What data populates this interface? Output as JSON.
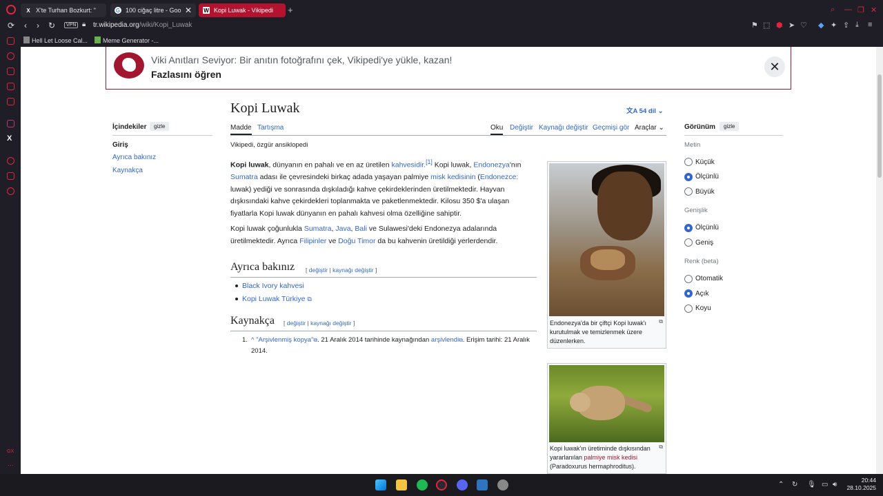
{
  "browser": {
    "tabs": [
      {
        "label": "X'te Turhan Bozkurt: \"",
        "favicon": "x-icon"
      },
      {
        "label": "100 ciğaç litre - Goo",
        "favicon": "google-icon"
      },
      {
        "label": "Kopi Luwak - Vikipedi",
        "favicon": "wikipedia-icon",
        "active": true
      }
    ],
    "vpn_label": "VPN",
    "url_domain": "tr.wikipedia.org",
    "url_path": "/wiki/Kopi_Luwak",
    "bookmarks": [
      "Hell Let Loose Cal...",
      "Meme Generator -..."
    ],
    "accent_color": "#e0263d",
    "active_tab_color": "#b3132e"
  },
  "banner": {
    "text": "Viki Anıtları Seviyor: Bir anıtın fotoğrafını çek, Vikipedi'ye yükle, kazan!",
    "link": "Fazlasını öğren",
    "close": "✕"
  },
  "toc": {
    "title": "İçindekiler",
    "hide": "gizle",
    "items": [
      "Giriş",
      "Ayrıca bakınız",
      "Kaynakça"
    ]
  },
  "article": {
    "title": "Kopi Luwak",
    "languages": "54 dil",
    "tabs_left": [
      "Madde",
      "Tartışma"
    ],
    "tabs_right": [
      "Oku",
      "Değiştir",
      "Kaynağı değiştir",
      "Geçmişi gör",
      "Araçlar"
    ],
    "tagline": "Vikipedi, özgür ansiklopedi",
    "p1": {
      "bold": "Kopi luwak",
      "t1": ", dünyanın en pahalı ve en az üretilen ",
      "l1": "kahvesidir.",
      "sup": "[1]",
      "t2": " Kopi luwak, ",
      "l2": "Endonezya",
      "t3": "'nın ",
      "l3": "Sumatra",
      "t4": " adası ile çevresindeki birkaç adada yaşayan palmiye ",
      "l4": "misk kedisinin",
      "t5": " (",
      "l5": "Endonezce:",
      "t6": " luwak) yediği ve sonrasında dışkıladığı kahve çekirdeklerinden üretilmektedir. Hayvan dışkısındaki kahve çekirdekleri toplanmakta ve paketlenmektedir. Kilosu 350 $'a ulaşan fiyatlarla Kopi luwak dünyanın en pahalı kahvesi olma özelliğine sahiptir."
    },
    "p2": {
      "t1": "Kopi luwak çoğunlukla ",
      "l1": "Sumatra",
      "c1": ", ",
      "l2": "Java",
      "c2": ", ",
      "l3": "Bali",
      "t2": " ve Sulawesi'deki Endonezya adalarında üretilmektedir. Ayrıca ",
      "l4": "Filipinler",
      "t3": " ve ",
      "l5": "Doğu Timor",
      "t4": " da bu kahvenin üretildiği yerlerdendir."
    },
    "see_also": {
      "heading": "Ayrıca bakınız",
      "edit_open": "[ ",
      "edit": "değiştir",
      "sep": " | ",
      "edit_src": "kaynağı değiştir",
      "edit_close": " ]",
      "items": [
        "Black Ivory kahvesi",
        "Kopi Luwak Türkiye"
      ]
    },
    "references": {
      "heading": "Kaynakça",
      "edit_open": "[ ",
      "edit": "değiştir",
      "sep": " | ",
      "edit_src": "kaynağı değiştir",
      "edit_close": " ]",
      "num": "1.",
      "caret": "^",
      "link1": "\"Arşivlenmiş kopya\"",
      "text1": ". 21 Aralık 2014 tarihinde kaynağından ",
      "link2": "arşivlendi",
      "text2": ". Erişim tarihi: 21 Aralık 2014."
    },
    "image1_caption": "Endonezya'da bir çiftçi Kopi luwak'ı kurutulmak ve temizlenmek üzere düzenlerken.",
    "image2_caption_t1": "Kopi luwak'ın üretiminde dışkısından yararlanılan ",
    "image2_caption_link": "palmiye misk kedisi",
    "image2_caption_t2": " (Paradoxurus hermaphroditus)."
  },
  "appearance": {
    "title": "Görünüm",
    "hide": "gizle",
    "text_label": "Metin",
    "text_options": [
      "Küçük",
      "Ölçünlü",
      "Büyük"
    ],
    "text_selected": "Ölçünlü",
    "width_label": "Genişlik",
    "width_options": [
      "Ölçünlü",
      "Geniş"
    ],
    "width_selected": "Ölçünlü",
    "color_label": "Renk (beta)",
    "color_options": [
      "Otomatik",
      "Açık",
      "Koyu"
    ],
    "color_selected": "Açık"
  },
  "taskbar": {
    "time": "20:44",
    "date": "28.10.2025"
  }
}
